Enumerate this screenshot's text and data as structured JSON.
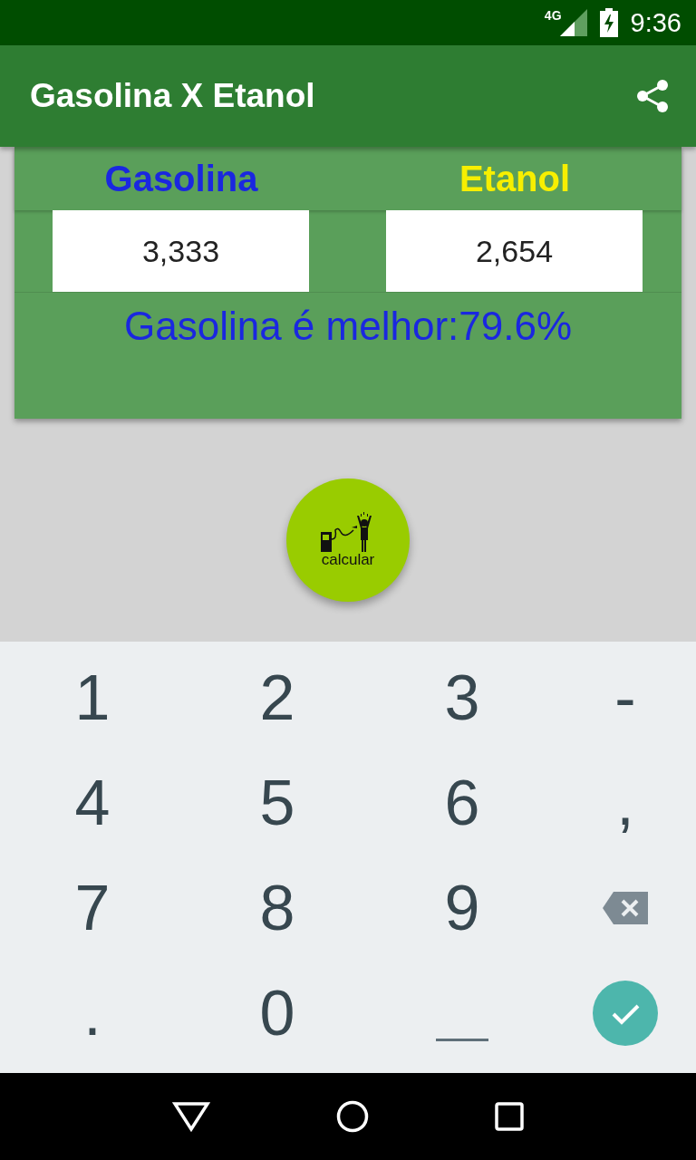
{
  "status_bar": {
    "network": "4G",
    "time": "9:36"
  },
  "app_bar": {
    "title": "Gasolina X Etanol"
  },
  "fuels": [
    {
      "label": "Gasolina",
      "color": "#1a27e0",
      "value": "3,333"
    },
    {
      "label": "Etanol",
      "color": "#f7ef00",
      "value": "2,654"
    }
  ],
  "result": "Gasolina é melhor:79.6%",
  "fab": {
    "label": "calcular"
  },
  "keyboard": {
    "keys": [
      {
        "kind": "text",
        "label": "1"
      },
      {
        "kind": "text",
        "label": "2"
      },
      {
        "kind": "text",
        "label": "3"
      },
      {
        "kind": "text",
        "label": "-"
      },
      {
        "kind": "text",
        "label": "4"
      },
      {
        "kind": "text",
        "label": "5"
      },
      {
        "kind": "text",
        "label": "6"
      },
      {
        "kind": "text",
        "label": ","
      },
      {
        "kind": "text",
        "label": "7"
      },
      {
        "kind": "text",
        "label": "8"
      },
      {
        "kind": "text",
        "label": "9"
      },
      {
        "kind": "backspace"
      },
      {
        "kind": "text",
        "label": "."
      },
      {
        "kind": "text",
        "label": "0"
      },
      {
        "kind": "space"
      },
      {
        "kind": "done"
      }
    ]
  }
}
